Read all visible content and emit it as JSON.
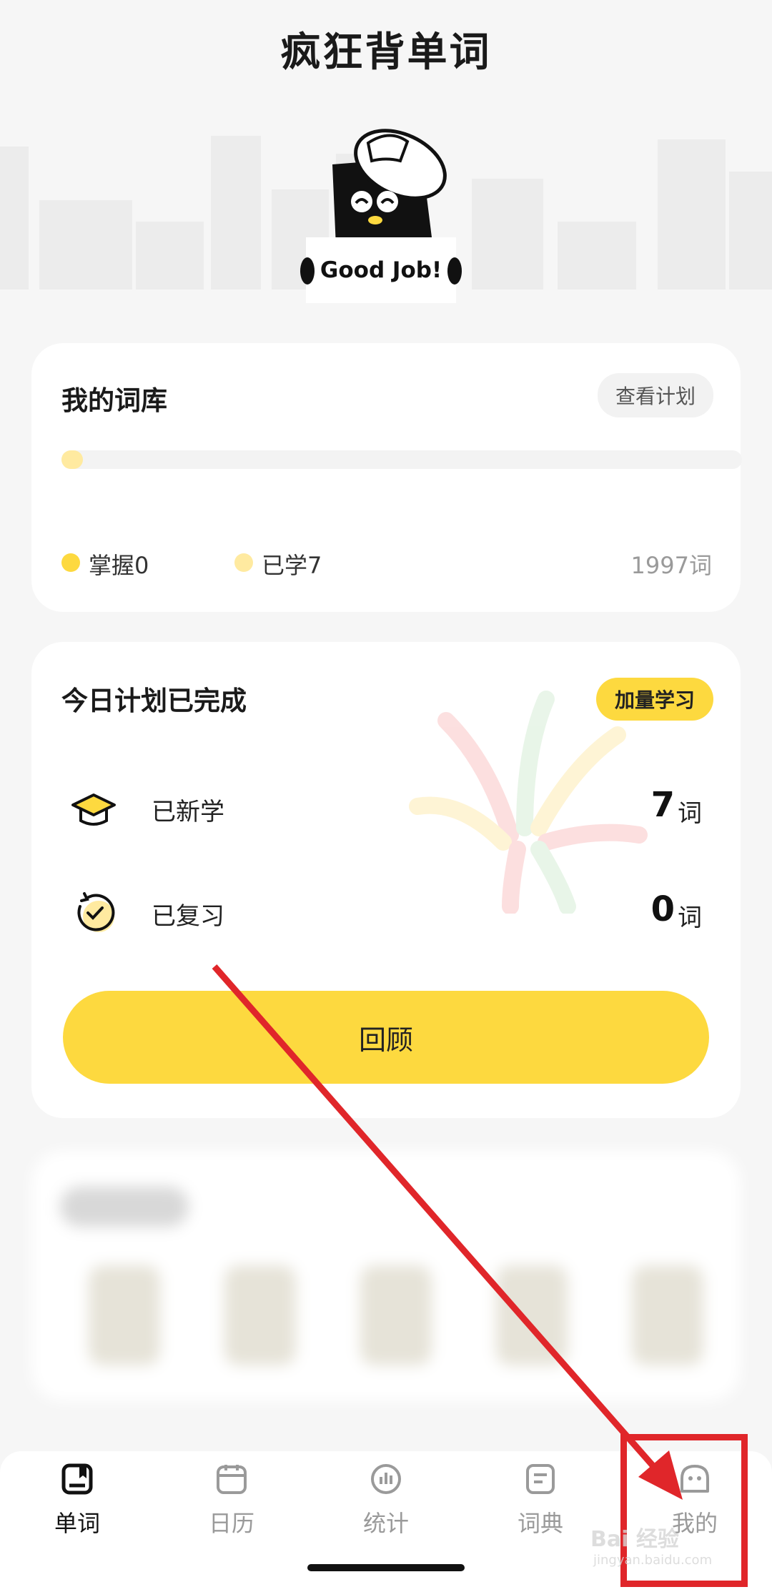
{
  "app": {
    "title": "疯狂背单词"
  },
  "mascot": {
    "sign_text": "Good Job!"
  },
  "vocab_card": {
    "title": "我的词库",
    "view_plan_button": "查看计划",
    "progress_fraction": 0.0035,
    "mastered_label": "掌握0",
    "learned_label": "已学7",
    "total_label": "1997词",
    "colors": {
      "mastered": "#fdd93f",
      "learned": "#ffeaa0"
    }
  },
  "plan_card": {
    "title": "今日计划已完成",
    "add_study_button": "加量学习",
    "new_learned_label": "已新学",
    "new_learned_count": "7",
    "reviewed_label": "已复习",
    "reviewed_count": "0",
    "unit": "词",
    "review_button": "回顾"
  },
  "tabbar": {
    "tabs": [
      {
        "label": "单词",
        "icon": "book-icon",
        "active": true
      },
      {
        "label": "日历",
        "icon": "calendar-icon",
        "active": false
      },
      {
        "label": "统计",
        "icon": "stats-icon",
        "active": false
      },
      {
        "label": "词典",
        "icon": "dictionary-icon",
        "active": false
      },
      {
        "label": "我的",
        "icon": "profile-icon",
        "active": false
      }
    ]
  },
  "watermark": {
    "text": "Bai 经验",
    "sub": "jingyan.baidu.com"
  },
  "colors": {
    "accent": "#fdd93f",
    "annotation_red": "#e0262a"
  }
}
